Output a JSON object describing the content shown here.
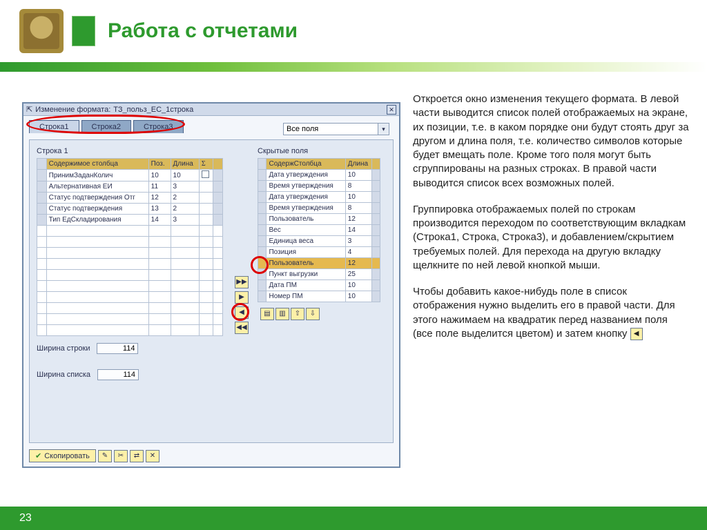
{
  "slide": {
    "title": "Работа с отчетами",
    "page_number": "23",
    "para1": "Откроется окно изменения текущего формата. В левой части выводится список полей отображаемых на экране, их позиции, т.е. в каком порядке они будут стоять друг за другом и длина поля, т.е. количество символов которые будет вмещать поле. Кроме того поля могут быть сгруппированы на разных строках. В правой части выводится список всех возможных полей.",
    "para2": "Группировка отображаемых полей по строкам производится переходом по соответствующим вкладкам (Строка1, Строка, Строка3), и добавлением/скрытием требуемых полей. Для перехода на другую вкладку щелкните по ней левой кнопкой мыши.",
    "para3a": "Чтобы добавить какое-нибудь поле в список отображения нужно выделить его в правой части. Для этого нажимаем на квадратик перед названием поля (все поле выделится цветом) и затем кнопку",
    "inline_btn_glyph": "◀"
  },
  "sap": {
    "title_prefix": "Изменение формата:",
    "title_value": "ТЗ_польз_ЕС_1строка",
    "close": "✕",
    "tabs": [
      "Строка1",
      "Строка2",
      "Строка3"
    ],
    "all_fields_label": "Все поля",
    "left": {
      "panel_title": "Строка 1",
      "cols": {
        "content": "Содержимое столбца",
        "pos": "Поз.",
        "len": "Длина",
        "sum": "Σ"
      },
      "rows": [
        {
          "c": "ПринимЗаданКолич",
          "p": "10",
          "l": "10",
          "chk": true
        },
        {
          "c": "Альтернативная ЕИ",
          "p": "11",
          "l": "3"
        },
        {
          "c": "Статус подтверждения Отг",
          "p": "12",
          "l": "2"
        },
        {
          "c": "Статус подтверждения",
          "p": "13",
          "l": "2"
        },
        {
          "c": "Тип ЕдСкладирования",
          "p": "14",
          "l": "3"
        }
      ],
      "width_row_label": "Ширина строки",
      "width_row_value": "114",
      "width_list_label": "Ширина списка",
      "width_list_value": "114"
    },
    "right": {
      "panel_title": "Скрытые поля",
      "cols": {
        "content": "СодержСтолбца",
        "len": "Длина"
      },
      "rows": [
        {
          "c": "Дата утверждения",
          "l": "10"
        },
        {
          "c": "Время утверждения",
          "l": "8"
        },
        {
          "c": "Дата утверждения",
          "l": "10"
        },
        {
          "c": "Время утверждения",
          "l": "8"
        },
        {
          "c": "Пользователь",
          "l": "12"
        },
        {
          "c": "Вес",
          "l": "14"
        },
        {
          "c": "Единица веса",
          "l": "3"
        },
        {
          "c": "Позиция",
          "l": "4"
        },
        {
          "c": "Пользователь",
          "l": "12",
          "sel": true
        },
        {
          "c": "Пункт выгрузки",
          "l": "25"
        },
        {
          "c": "Дата ПМ",
          "l": "10"
        },
        {
          "c": "Номер ПМ",
          "l": "10"
        }
      ]
    },
    "movers": {
      "all_right": "▶▶",
      "right": "▶",
      "left": "◀",
      "all_left": "◀◀"
    },
    "copy": "Скопировать",
    "tool_icons": [
      "✎",
      "✂",
      "⇄",
      "✕"
    ],
    "right_tools": [
      "▤",
      "▥",
      "⇧",
      "⇩"
    ]
  }
}
